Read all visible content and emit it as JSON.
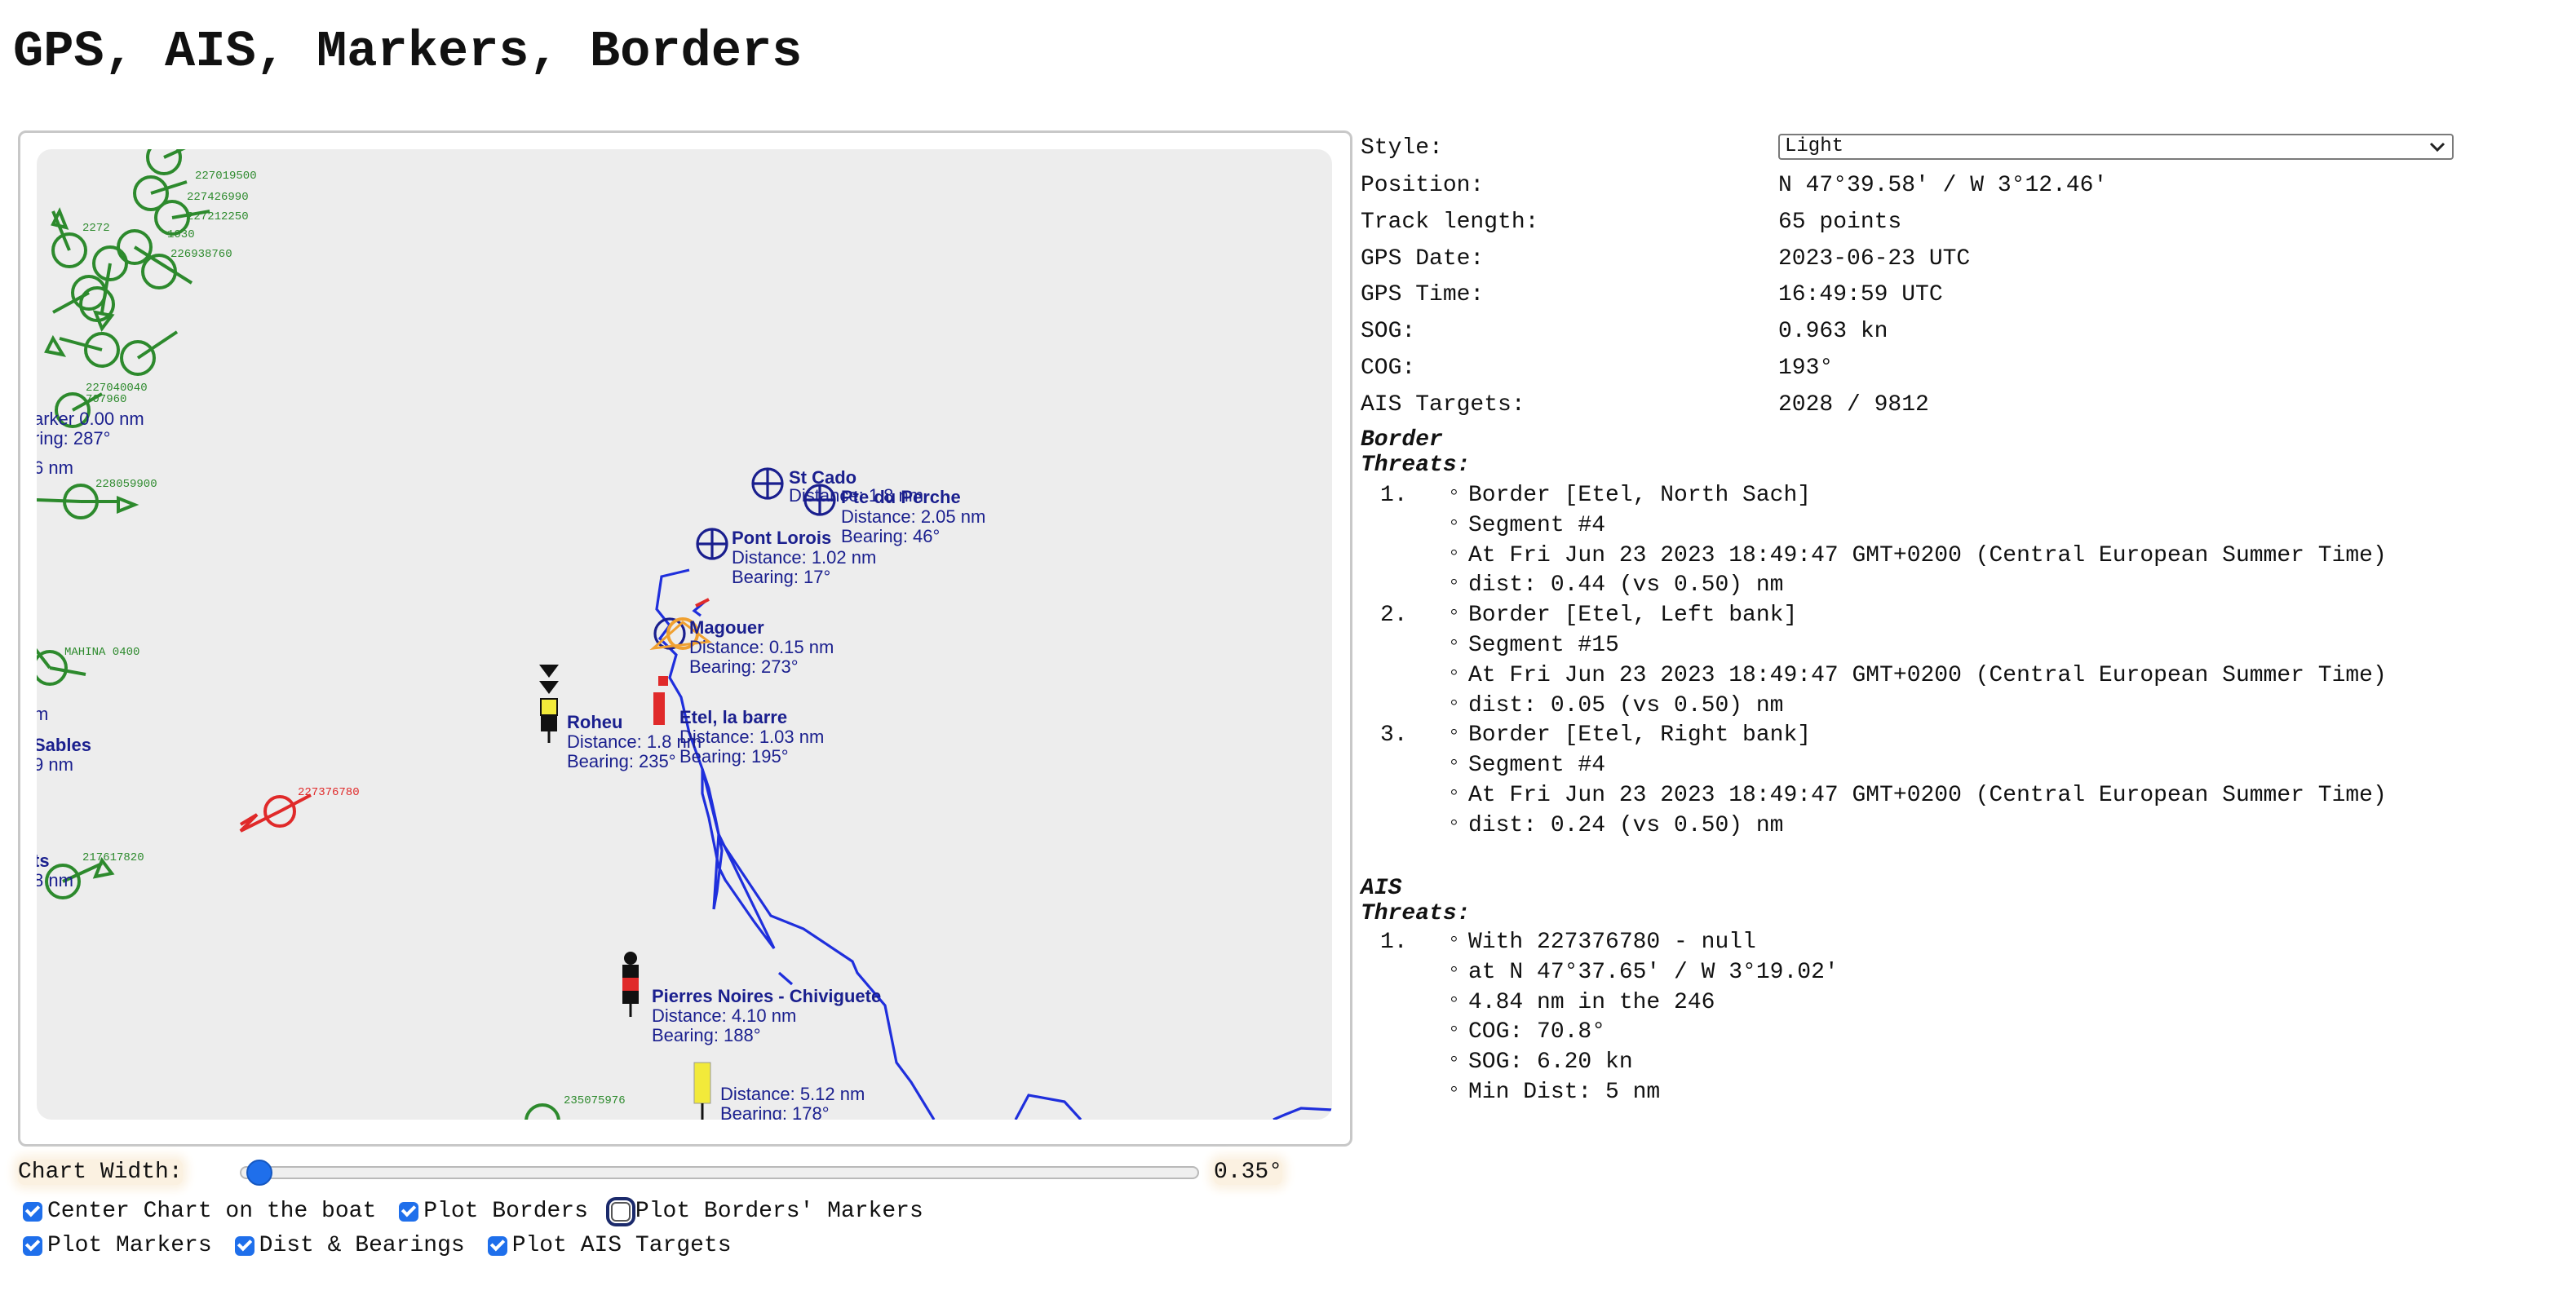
{
  "page_title": "GPS, AIS, Markers, Borders",
  "chart": {
    "markers": [
      {
        "name": "St Cado",
        "distance": "Distance: 1.8 nm",
        "bearing": ""
      },
      {
        "name": "Pte du Perche",
        "distance": "Distance: 2.05 nm",
        "bearing": "Bearing: 46°"
      },
      {
        "name": "Pont Lorois",
        "distance": "Distance: 1.02 nm",
        "bearing": "Bearing: 17°"
      },
      {
        "name": "Magouer",
        "distance": "Distance: 0.15 nm",
        "bearing": "Bearing: 273°"
      },
      {
        "name": "Roheu",
        "distance": "Distance: 1.8 nm",
        "bearing": "Bearing: 235°"
      },
      {
        "name": "Etel, la barre",
        "distance": "Distance: 1.03 nm",
        "bearing": "Bearing: 195°"
      },
      {
        "name": "Pierres Noires - Chiviguete",
        "distance": "Distance: 4.10 nm",
        "bearing": "Bearing: 188°"
      },
      {
        "name": "",
        "distance": "Distance: 5.12 nm",
        "bearing": "Bearing: 178°"
      }
    ],
    "edge_labels": [
      "arker 0.00 nm",
      "ring: 287°",
      "6 nm",
      "m",
      "Sables",
      "9 nm",
      "ts",
      "8 nm"
    ],
    "ais_labels": [
      "227019500",
      "227426990",
      "227212250",
      "2272",
      "1030",
      "226938760",
      "227040040",
      "707960",
      "228059900",
      "MAHINA 0400",
      "217617820",
      "235075976"
    ],
    "ais_threat_label": "227376780",
    "colors": {
      "ais": "#2d8a2d",
      "ais_threat": "#e02a2a",
      "track": "#1f2fdc",
      "marker_text": "#1a1f8e"
    }
  },
  "controls": {
    "chart_width_label": "Chart Width:",
    "chart_width_value": "0.35°",
    "chart_width_fraction": 0.0,
    "checkboxes_row1": [
      {
        "label": "Center Chart on the boat",
        "checked": true
      },
      {
        "label": "Plot Borders",
        "checked": true
      },
      {
        "label": "Plot Borders' Markers",
        "checked": false
      }
    ],
    "checkboxes_row2": [
      {
        "label": "Plot Markers",
        "checked": true
      },
      {
        "label": "Dist & Bearings",
        "checked": true
      },
      {
        "label": "Plot AIS Targets",
        "checked": true
      }
    ]
  },
  "info": {
    "style_label": "Style:",
    "style_value": "Light",
    "rows": [
      {
        "key": "Position:",
        "value": "N 47°39.58' / W 3°12.46'"
      },
      {
        "key": "Track length:",
        "value": "65 points"
      },
      {
        "key": "GPS Date:",
        "value": "2023-06-23 UTC"
      },
      {
        "key": "GPS Time:",
        "value": "16:49:59 UTC"
      },
      {
        "key": "SOG:",
        "value": "0.963 kn"
      },
      {
        "key": "COG:",
        "value": "193°"
      },
      {
        "key": "AIS Targets:",
        "value": "2028 / 9812"
      }
    ],
    "border_threats_title": "Border Threats:",
    "border_threats": [
      {
        "num": "1.",
        "lines": [
          "Border [Etel, North Sach]",
          "Segment #4",
          "At Fri Jun 23 2023 18:49:47 GMT+0200 (Central European Summer Time)",
          "dist: 0.44 (vs 0.50) nm"
        ]
      },
      {
        "num": "2.",
        "lines": [
          "Border [Etel, Left bank]",
          "Segment #15",
          "At Fri Jun 23 2023 18:49:47 GMT+0200 (Central European Summer Time)",
          "dist: 0.05 (vs 0.50) nm"
        ]
      },
      {
        "num": "3.",
        "lines": [
          "Border [Etel, Right bank]",
          "Segment #4",
          "At Fri Jun 23 2023 18:49:47 GMT+0200 (Central European Summer Time)",
          "dist: 0.24 (vs 0.50) nm"
        ]
      }
    ],
    "ais_threats_title": "AIS Threats:",
    "ais_threats": [
      {
        "num": "1.",
        "lines": [
          "With 227376780 - null",
          "at N 47°37.65' / W 3°19.02'",
          "4.84 nm in the 246",
          "COG: 70.8°",
          "SOG: 6.20 kn",
          "Min Dist: 5 nm"
        ]
      }
    ]
  }
}
